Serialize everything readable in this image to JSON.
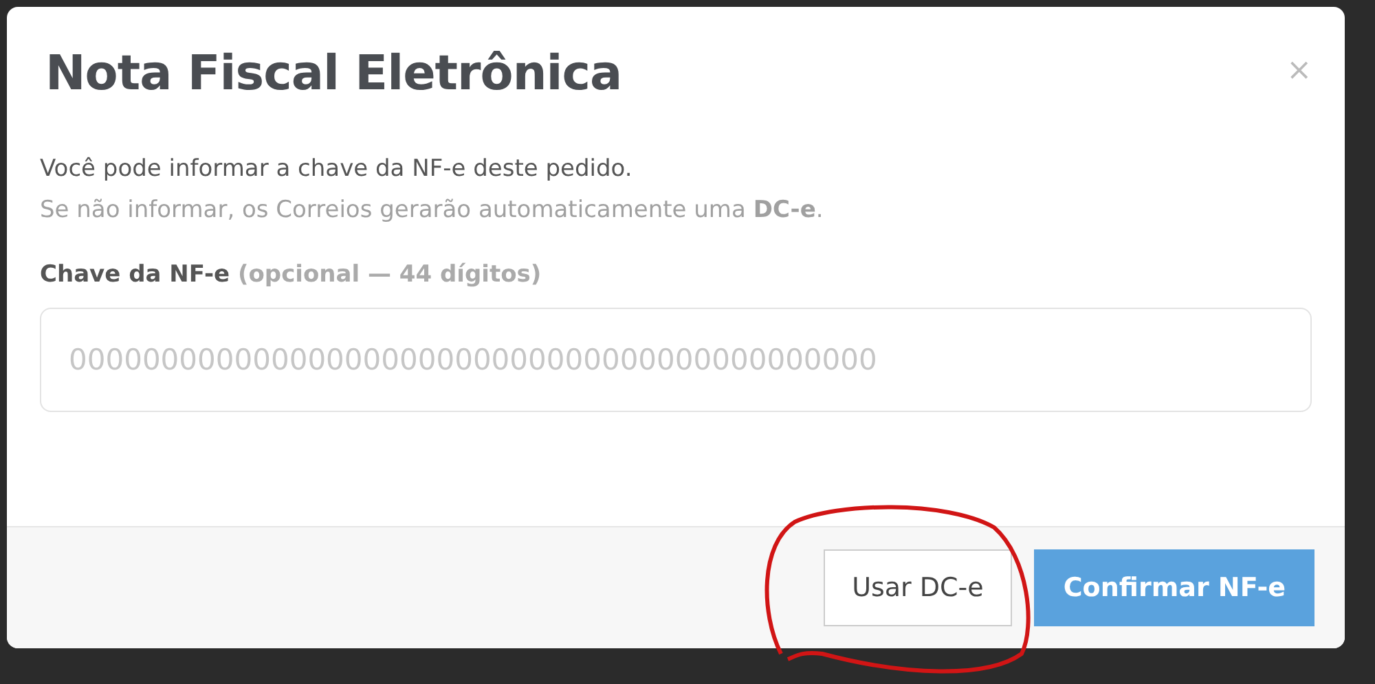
{
  "modal": {
    "title": "Nota Fiscal Eletrônica",
    "close": "×",
    "intro": "Você pode informar a chave da NF-e deste pedido.",
    "hint": "Se não informar, os Correios gerarão automaticamente uma **DC-e**.",
    "field": {
      "label": "Chave da NF-e",
      "label_note": "(opcional — 44 dígitos)",
      "placeholder": "00000000000000000000000000000000000000000000"
    },
    "buttons": [
      {
        "label": "Usar DC-e",
        "kind": "secondary"
      },
      {
        "label": "Confirmar NF-e",
        "kind": "primary"
      }
    ]
  },
  "annotation": {
    "kind": "circle"
  }
}
